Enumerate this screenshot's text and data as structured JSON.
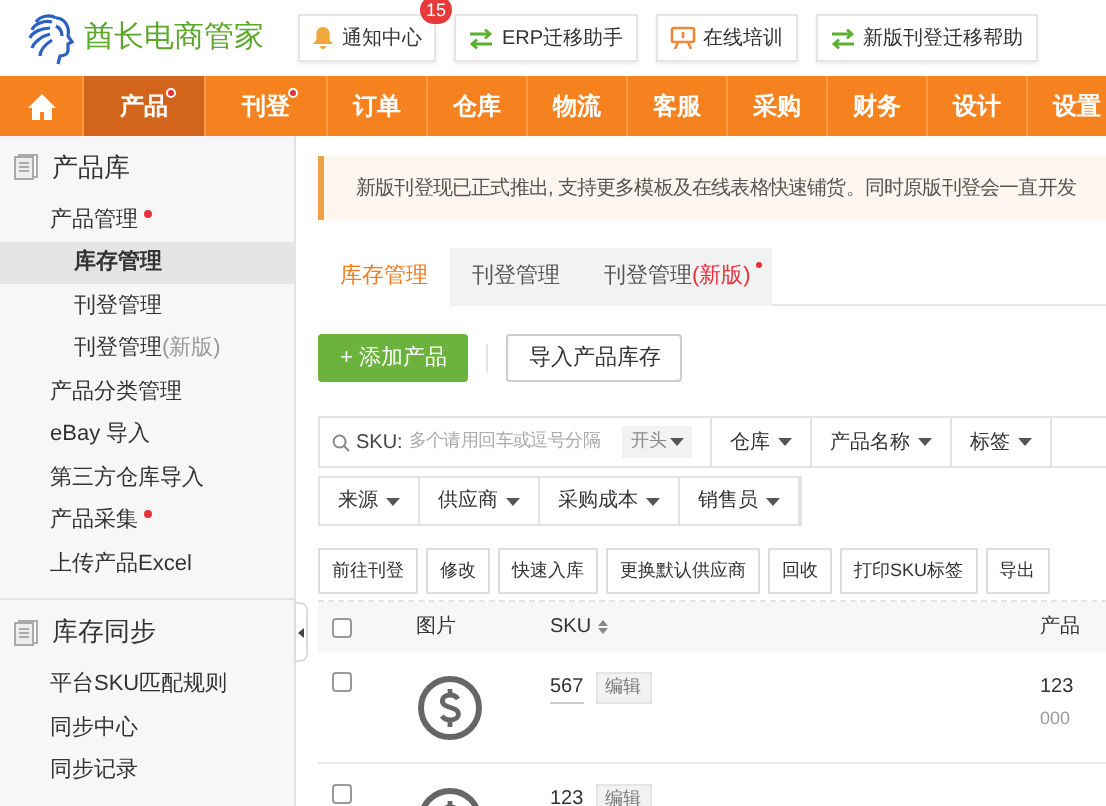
{
  "header": {
    "logo_text": "酋长电商管家",
    "buttons": [
      {
        "kind": "bell",
        "label": "通知中心",
        "badge": "15"
      },
      {
        "kind": "swap",
        "label": "ERP迁移助手"
      },
      {
        "kind": "training",
        "label": "在线培训"
      },
      {
        "kind": "swap",
        "label": "新版刊登迁移帮助"
      }
    ]
  },
  "nav": [
    {
      "kind": "home",
      "selected": false
    },
    {
      "label": "产品",
      "selected": true,
      "dot": true
    },
    {
      "label": "刊登",
      "selected": false,
      "dot": true
    },
    {
      "label": "订单",
      "selected": false,
      "dot": false
    },
    {
      "label": "仓库",
      "selected": false,
      "dot": false
    },
    {
      "label": "物流",
      "selected": false,
      "dot": false
    },
    {
      "label": "客服",
      "selected": false,
      "dot": false
    },
    {
      "label": "采购",
      "selected": false,
      "dot": false
    },
    {
      "label": "财务",
      "selected": false,
      "dot": false
    },
    {
      "label": "设计",
      "selected": false,
      "dot": false
    },
    {
      "label": "设置",
      "selected": false,
      "dot": false
    }
  ],
  "sidebar": [
    {
      "title": "产品库",
      "items": [
        {
          "label": "产品管理",
          "dot": true,
          "selected": false,
          "children": [
            {
              "label": "库存管理",
              "selected": true
            },
            {
              "label": "刊登管理",
              "selected": false
            },
            {
              "label": "刊登管理",
              "note": "(新版)",
              "selected": false
            }
          ]
        },
        {
          "label": "产品分类管理",
          "dot": false,
          "selected": false
        },
        {
          "label": "eBay 导入",
          "dot": false,
          "selected": false
        },
        {
          "label": "第三方仓库导入",
          "dot": false,
          "selected": false
        },
        {
          "label": "产品采集",
          "dot": true,
          "selected": false
        },
        {
          "label": "上传产品Excel",
          "dot": false,
          "selected": false
        }
      ]
    },
    {
      "title": "库存同步",
      "items": [
        {
          "label": "平台SKU匹配规则",
          "dot": false,
          "selected": false
        },
        {
          "label": "同步中心",
          "dot": false,
          "selected": false
        },
        {
          "label": "同步记录",
          "dot": false,
          "selected": false
        }
      ]
    }
  ],
  "notice": "新版刊登现已正式推出, 支持更多模板及在线表格快速铺货。同时原版刊登会一直开发",
  "tabs": [
    {
      "label": "库存管理",
      "selected": true,
      "dot": false
    },
    {
      "label": "刊登管理",
      "selected": false,
      "dot": false
    },
    {
      "label": "刊登管理",
      "note": "(新版)",
      "selected": false,
      "dot": true
    }
  ],
  "primary_buttons": [
    {
      "kind": "primary",
      "label": "+ 添加产品"
    },
    {
      "kind": "default",
      "label": "导入产品库存"
    }
  ],
  "search": {
    "label": "SKU:",
    "placeholder": "多个请用回车或逗号分隔",
    "match": "开头"
  },
  "filters_row_1": [
    "仓库",
    "产品名称",
    "标签"
  ],
  "filters_row_2": [
    "来源",
    "供应商",
    "采购成本",
    "销售员"
  ],
  "actions": [
    "前往刊登",
    "修改",
    "快速入库",
    "更换默认供应商",
    "回收",
    "打印SKU标签",
    "导出"
  ],
  "table": {
    "select_all_checked": false,
    "columns": [
      "图片",
      "SKU",
      "产品"
    ],
    "rows": [
      {
        "checked": false,
        "sku": "567",
        "edit": "编辑",
        "product": "123",
        "product_sub": "000"
      },
      {
        "checked": false,
        "sku": "123",
        "edit": "编辑"
      }
    ]
  }
}
